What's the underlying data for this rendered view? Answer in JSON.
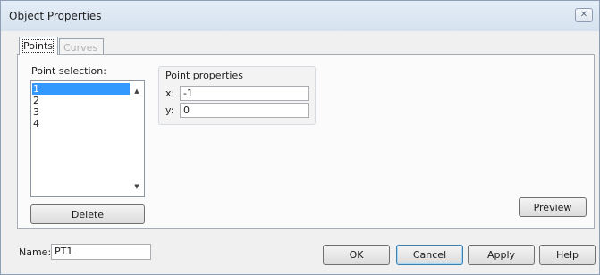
{
  "window": {
    "title": "Object Properties",
    "close_glyph": "✕"
  },
  "tabs": [
    {
      "label": "Points",
      "active": true
    },
    {
      "label": "Curves",
      "active": false
    }
  ],
  "point_selection": {
    "label": "Point selection:",
    "items": [
      "1",
      "2",
      "3",
      "4"
    ],
    "selected_index": 0
  },
  "point_properties": {
    "label": "Point properties",
    "x_label": "x:",
    "x_value": "-1",
    "y_label": "y:",
    "y_value": "0"
  },
  "buttons": {
    "delete": "Delete",
    "preview": "Preview",
    "ok": "OK",
    "cancel": "Cancel",
    "apply": "Apply",
    "help": "Help"
  },
  "name_field": {
    "label": "Name:",
    "value": "PT1"
  },
  "icons": {
    "scroll_up": "▲",
    "scroll_down": "▼"
  }
}
